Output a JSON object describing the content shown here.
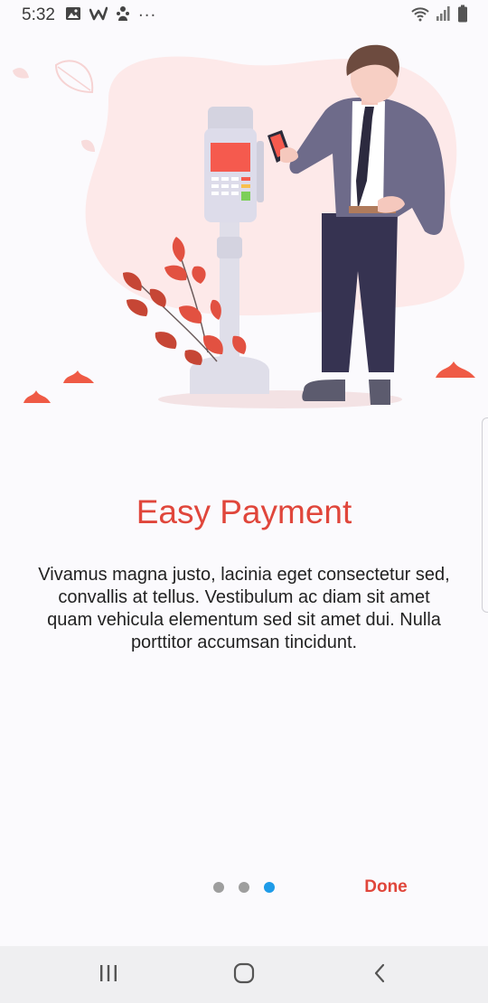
{
  "status_bar": {
    "time": "5:32",
    "left_icons": [
      "gallery-icon",
      "w-app-icon",
      "character-app-icon",
      "more-notifications-icon"
    ],
    "more_label": "···",
    "right_icons": [
      "wifi-icon",
      "signal-icon",
      "battery-icon"
    ]
  },
  "onboarding": {
    "title": "Easy Payment",
    "description": "Vivamus magna justo, lacinia eget consectetur sed, convallis at tellus. Vestibulum ac diam sit amet quam vehicula elementum sed sit amet dui. Nulla porttitor accumsan tincidunt.",
    "illustration": "man-paying-with-phone-at-terminal",
    "pager": {
      "total": 3,
      "current": 3
    },
    "done_label": "Done"
  },
  "colors": {
    "accent": "#e0463b",
    "active_dot": "#1e9be8",
    "inactive_dot": "#9e9e9e",
    "background": "#fbfafd"
  },
  "nav_bar": {
    "buttons": [
      "recent-apps-icon",
      "home-icon",
      "back-icon"
    ]
  }
}
